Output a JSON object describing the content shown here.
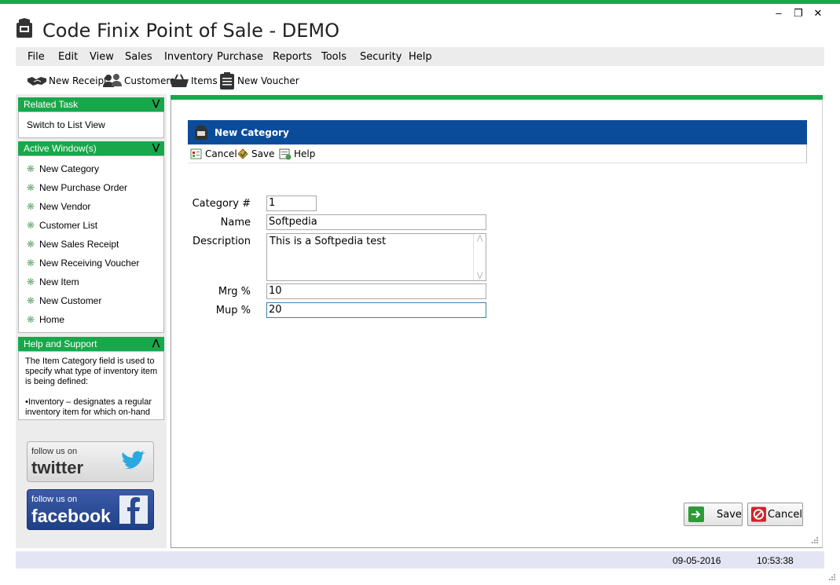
{
  "window": {
    "title": "Code Finix Point of Sale - DEMO",
    "controls": {
      "minimize": "‒",
      "restore": "❐",
      "close": "✕"
    }
  },
  "menu": [
    "File",
    "Edit",
    "View",
    "Sales",
    "Inventory",
    "Purchase",
    "Reports",
    "Tools",
    "Security",
    "Help"
  ],
  "toolbar": {
    "new_receipt": "New Receipt",
    "customers": "Customers",
    "items": "Items",
    "new_voucher": "New Voucher"
  },
  "sidebar": {
    "related_task": {
      "title": "Related Task",
      "links": [
        "Switch to List View"
      ]
    },
    "active_windows": {
      "title": "Active Window(s)",
      "items": [
        "New Category",
        "New Purchase Order",
        "New Vendor",
        "Customer List",
        "New Sales Receipt",
        "New Receiving Voucher",
        "New Item",
        "New Customer",
        "Home"
      ]
    },
    "help_support": {
      "title": "Help and Support",
      "text1": "The Item Category field is used to specify what type of inventory item is being defined:",
      "text2": "•Inventory – designates a regular inventory item for which on-hand"
    },
    "social": {
      "twitter_follow": "follow us on",
      "twitter_brand": "twitter",
      "facebook_follow": "follow us on",
      "facebook_brand": "facebook"
    }
  },
  "form": {
    "title": "New Category",
    "toolbar": {
      "cancel": "Cancel",
      "save": "Save",
      "help": "Help"
    },
    "fields": {
      "category_label": "Category #",
      "category_value": "1",
      "name_label": "Name",
      "name_value": "Softpedia",
      "description_label": "Description",
      "description_value": "This is a Softpedia test",
      "mrg_label": "Mrg %",
      "mrg_value": "10",
      "mup_label": "Mup %",
      "mup_value": "20"
    },
    "buttons": {
      "save": "Save",
      "cancel": "Cancel"
    }
  },
  "status": {
    "date": "09-05-2016",
    "time": "10:53:38"
  },
  "colors": {
    "accent_green": "#18a84b",
    "form_header_blue": "#0b4c9a",
    "status_bar": "#e4e4f4"
  }
}
